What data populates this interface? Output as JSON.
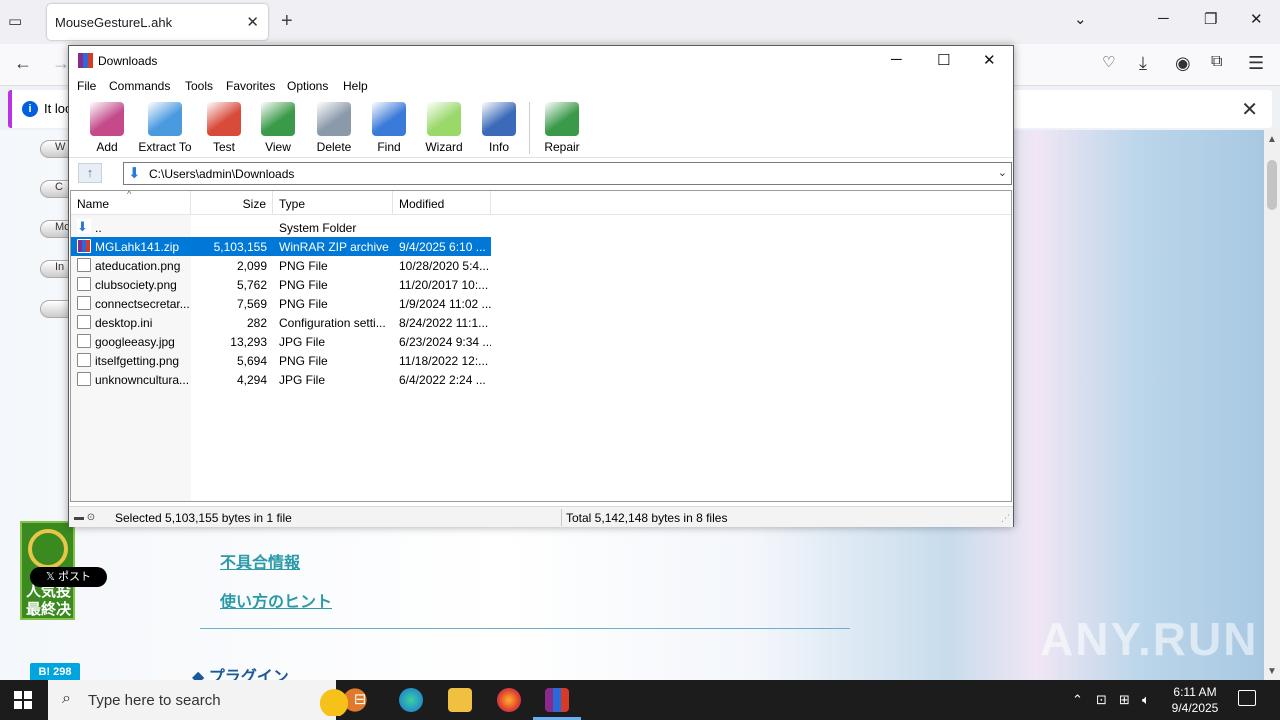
{
  "browser": {
    "tab_title": "MouseGestureL.ahk",
    "notice_text": "It loo"
  },
  "page": {
    "pills": [
      "W",
      "C",
      "Mo",
      "In",
      ""
    ],
    "award_text": "人気投\n最終决",
    "x_post": "𝕏 ポスト",
    "hatebu": "B! 298",
    "link_bugs": "不具合情報",
    "link_hints": "使い方のヒント",
    "plugin_heading": "◆ プラグイン",
    "watermark": "ANY.RUN"
  },
  "winrar": {
    "title": "Downloads",
    "menu": [
      "File",
      "Commands",
      "Tools",
      "Favorites",
      "Options",
      "Help"
    ],
    "toolbar": [
      {
        "label": "Add",
        "icon": "add-archive-icon",
        "color": "#c44a8a"
      },
      {
        "label": "Extract To",
        "icon": "extract-folder-icon",
        "color": "#4a9ae0"
      },
      {
        "label": "Test",
        "icon": "test-clipboard-icon",
        "color": "#d84a3a"
      },
      {
        "label": "View",
        "icon": "view-book-icon",
        "color": "#3a9a4a"
      },
      {
        "label": "Delete",
        "icon": "delete-trash-icon",
        "color": "#8a9aaa"
      },
      {
        "label": "Find",
        "icon": "find-magnifier-icon",
        "color": "#3a7ad8"
      },
      {
        "label": "Wizard",
        "icon": "wizard-wand-icon",
        "color": "#9ad86a"
      },
      {
        "label": "Info",
        "icon": "info-circle-icon",
        "color": "#3a6ab8"
      },
      {
        "label": "Repair",
        "icon": "repair-kit-icon",
        "color": "#3a9a4a"
      }
    ],
    "path": "C:\\Users\\admin\\Downloads",
    "columns": {
      "name": "Name",
      "size": "Size",
      "type": "Type",
      "modified": "Modified"
    },
    "files": [
      {
        "name": "..",
        "size": "",
        "type": "System Folder",
        "modified": "",
        "icon": "folder-up-icon"
      },
      {
        "name": "MGLahk141.zip",
        "size": "5,103,155",
        "type": "WinRAR ZIP archive",
        "modified": "9/4/2025 6:10 ...",
        "icon": "zip-archive-icon",
        "selected": true
      },
      {
        "name": "ateducation.png",
        "size": "2,099",
        "type": "PNG File",
        "modified": "10/28/2020 5:4...",
        "icon": "image-file-icon"
      },
      {
        "name": "clubsociety.png",
        "size": "5,762",
        "type": "PNG File",
        "modified": "11/20/2017 10:...",
        "icon": "image-file-icon"
      },
      {
        "name": "connectsecretar...",
        "size": "7,569",
        "type": "PNG File",
        "modified": "1/9/2024 11:02 ...",
        "icon": "image-file-icon"
      },
      {
        "name": "desktop.ini",
        "size": "282",
        "type": "Configuration setti...",
        "modified": "8/24/2022 11:1...",
        "icon": "settings-file-icon"
      },
      {
        "name": "googleeasy.jpg",
        "size": "13,293",
        "type": "JPG File",
        "modified": "6/23/2024 9:34 ...",
        "icon": "image-file-icon"
      },
      {
        "name": "itselfgetting.png",
        "size": "5,694",
        "type": "PNG File",
        "modified": "11/18/2022 12:...",
        "icon": "image-file-icon"
      },
      {
        "name": "unknowncultura...",
        "size": "4,294",
        "type": "JPG File",
        "modified": "6/4/2022 2:24 ...",
        "icon": "image-file-icon"
      }
    ],
    "status_selected": "Selected 5,103,155 bytes in 1 file",
    "status_total": "Total 5,142,148 bytes in 8 files"
  },
  "taskbar": {
    "search_placeholder": "Type here to search",
    "time": "6:11 AM",
    "date": "9/4/2025"
  }
}
